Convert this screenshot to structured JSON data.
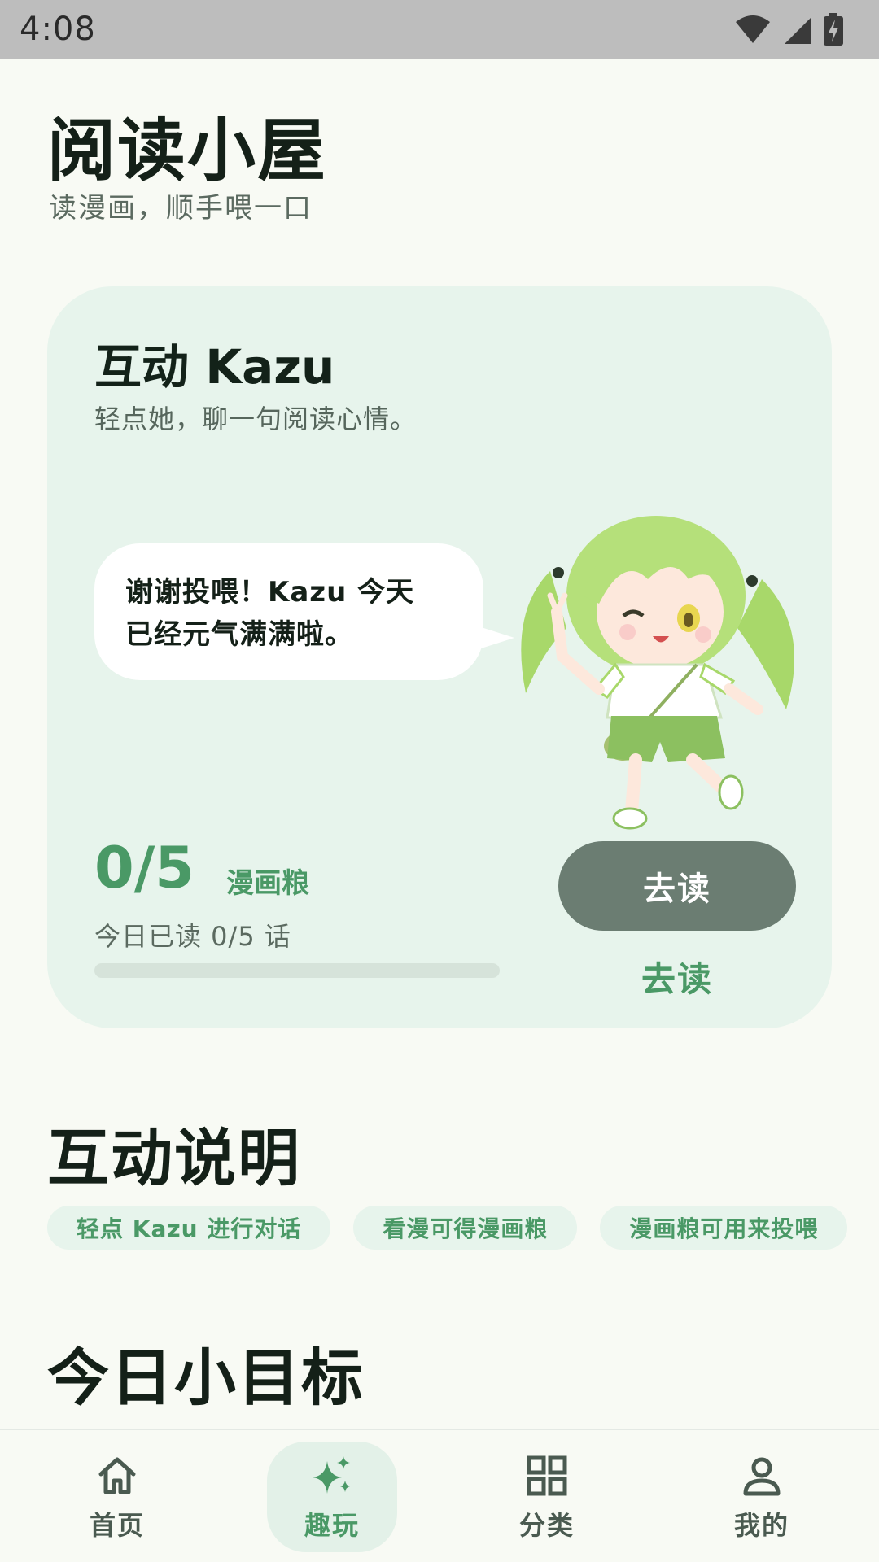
{
  "status_bar": {
    "time": "4:08",
    "icons": [
      "wifi-icon",
      "signal-icon",
      "battery-charging-icon"
    ]
  },
  "header": {
    "title": "阅读小屋",
    "subtitle": "读漫画，顺手喂一口"
  },
  "interact_card": {
    "title": "互动 Kazu",
    "description": "轻点她，聊一句阅读心情。",
    "speech_line1": "谢谢投喂！Kazu 今天",
    "speech_line2": "已经元气满满啦。",
    "count": "0/5",
    "count_unit": "漫画粮",
    "progress_text": "今日已读 0/5 话",
    "progress_fraction": 0,
    "button_label": "去读",
    "link_label": "去读"
  },
  "instructions": {
    "title": "互动说明",
    "chips": [
      "轻点 Kazu 进行对话",
      "看漫可得漫画粮",
      "漫画粮可用来投喂"
    ]
  },
  "goals": {
    "title": "今日小目标"
  },
  "bottom_nav": {
    "items": [
      {
        "label": "首页",
        "icon": "home-icon"
      },
      {
        "label": "趣玩",
        "icon": "sparkle-icon"
      },
      {
        "label": "分类",
        "icon": "grid-icon"
      },
      {
        "label": "我的",
        "icon": "person-icon"
      }
    ],
    "active_index": 1
  },
  "colors": {
    "accent": "#4a9966",
    "card_bg": "#e7f4ec",
    "button_bg": "#6b7d72",
    "page_bg": "#f8faf4"
  }
}
